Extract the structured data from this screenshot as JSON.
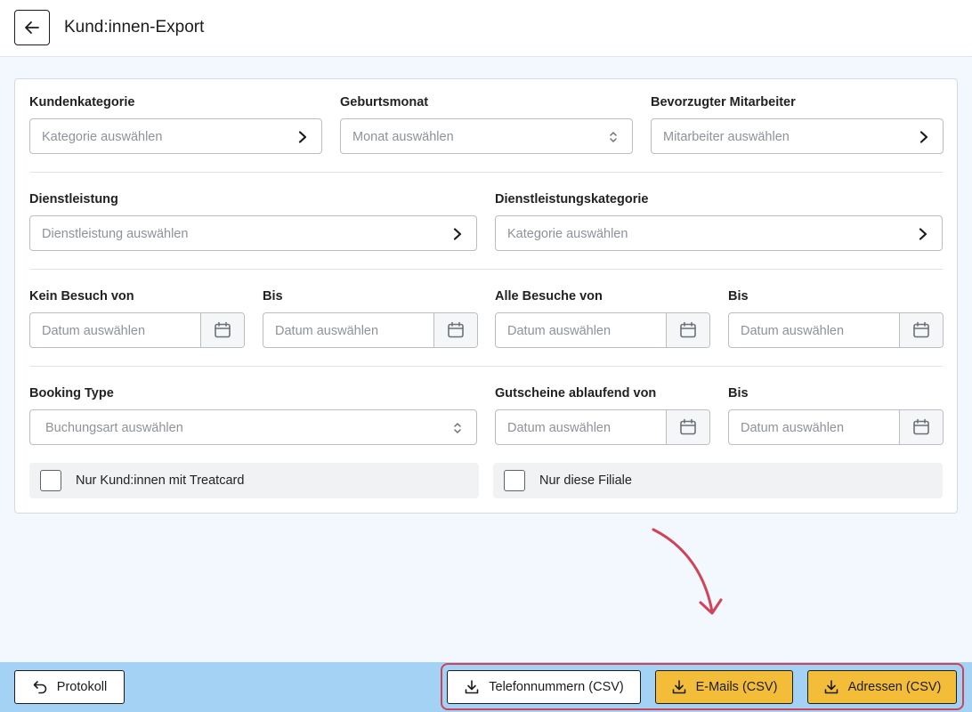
{
  "header": {
    "title": "Kund:innen-Export"
  },
  "filters": {
    "kundenkategorie": {
      "label": "Kundenkategorie",
      "placeholder": "Kategorie auswählen"
    },
    "geburtsmonat": {
      "label": "Geburtsmonat",
      "placeholder": "Monat auswählen"
    },
    "mitarbeiter": {
      "label": "Bevorzugter Mitarbeiter",
      "placeholder": "Mitarbeiter auswählen"
    },
    "dienstleistung": {
      "label": "Dienstleistung",
      "placeholder": "Dienstleistung auswählen"
    },
    "dienstleistungskategorie": {
      "label": "Dienstleistungskategorie",
      "placeholder": "Kategorie auswählen"
    },
    "kein_besuch_von": {
      "label": "Kein Besuch von",
      "placeholder": "Datum auswählen"
    },
    "kein_besuch_bis": {
      "label": "Bis",
      "placeholder": "Datum auswählen"
    },
    "alle_besuche_von": {
      "label": "Alle Besuche von",
      "placeholder": "Datum auswählen"
    },
    "alle_besuche_bis": {
      "label": "Bis",
      "placeholder": "Datum auswählen"
    },
    "booking_type": {
      "label": "Booking Type",
      "placeholder": "Buchungsart auswählen"
    },
    "gutscheine_von": {
      "label": "Gutscheine ablaufend von",
      "placeholder": "Datum auswählen"
    },
    "gutscheine_bis": {
      "label": "Bis",
      "placeholder": "Datum auswählen"
    },
    "treatcard": {
      "label": "Nur Kund:innen mit Treatcard",
      "checked": false
    },
    "filiale": {
      "label": "Nur diese Filiale",
      "checked": false
    }
  },
  "footer": {
    "protokoll": "Protokoll",
    "telefon": "Telefonnummern (CSV)",
    "emails": "E-Mails (CSV)",
    "adressen": "Adressen (CSV)"
  },
  "colors": {
    "accent_yellow": "#f3bd3a",
    "footer_bg": "#a3d2f5",
    "highlight": "#d04358"
  }
}
